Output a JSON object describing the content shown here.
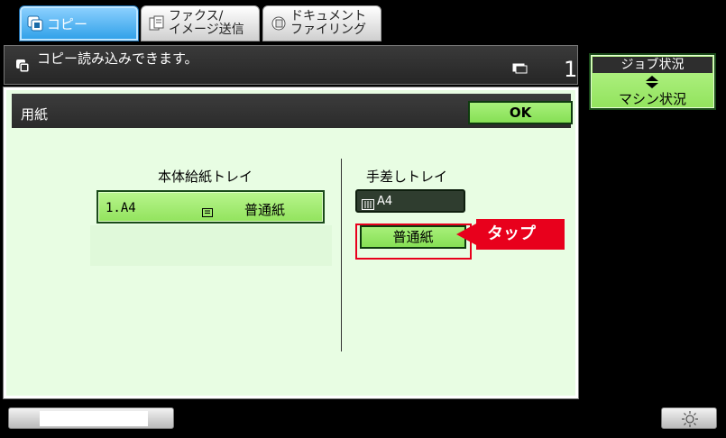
{
  "tabs": [
    {
      "label": "コピー",
      "active": true
    },
    {
      "label_line1": "ファクス/",
      "label_line2": "イメージ送信"
    },
    {
      "label_line1": "ドキュメント",
      "label_line2": "ファイリング"
    }
  ],
  "status": {
    "message": "コピー読み込みできます。",
    "count": "1"
  },
  "panel": {
    "title": "用紙",
    "ok_label": "OK",
    "main_tray": {
      "heading": "本体給紙トレイ",
      "size": "1.A4",
      "paper_type": "普通紙"
    },
    "bypass_tray": {
      "heading": "手差しトレイ",
      "size": "A4",
      "paper_type": "普通紙"
    }
  },
  "callout": {
    "label": "タップ"
  },
  "side": {
    "job_status": "ジョブ状況",
    "machine_status": "マシン状況"
  },
  "colors": {
    "accent_green": "#92e35d",
    "callout_red": "#e8001c",
    "panel_bg": "#e8fde3"
  }
}
